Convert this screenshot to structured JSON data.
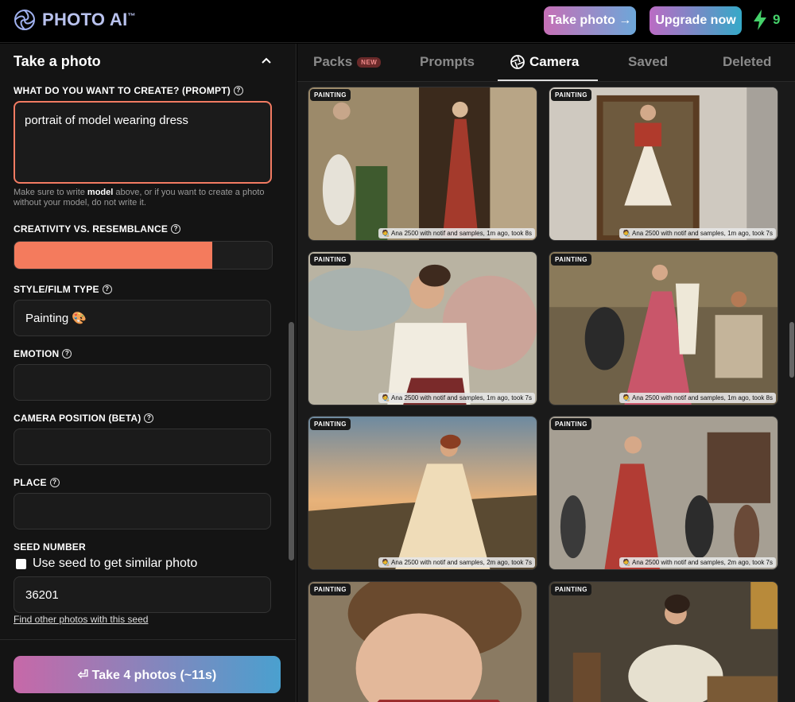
{
  "header": {
    "brand": "PHOTO AI",
    "brand_mark": "™",
    "take_photo_label": "Take photo →",
    "upgrade_label": "Upgrade now",
    "credits": "9",
    "colors": {
      "take_photo": "#c66fb6",
      "upgrade": "#35a9c8",
      "credits": "#45d16a"
    }
  },
  "form": {
    "section_title": "Take a photo",
    "prompt_label": "WHAT DO YOU WANT TO CREATE? (PROMPT)",
    "prompt_value": "portrait of model wearing dress",
    "hint_before": "Make sure to write ",
    "hint_bold": "model",
    "hint_after": " above, or if you want to create a photo without your model, do not write it.",
    "creativity_label": "CREATIVITY VS. RESEMBLANCE",
    "creativity_value": 0.77,
    "style_label": "STYLE/FILM TYPE",
    "style_value": "Painting 🎨",
    "emotion_label": "EMOTION",
    "emotion_value": "",
    "camera_label": "CAMERA POSITION (BETA)",
    "camera_value": "",
    "place_label": "PLACE",
    "place_value": "",
    "seed_label": "SEED NUMBER",
    "seed_checkbox_label": "Use seed to get similar photo",
    "seed_value": "36201",
    "seed_link": "Find other photos with this seed",
    "submit_label": "⏎ Take 4 photos (~11s)",
    "accent": "#f47b5d"
  },
  "tabs": [
    {
      "label": "Packs",
      "badge": "NEW"
    },
    {
      "label": "Prompts"
    },
    {
      "label": "Camera",
      "active": true
    },
    {
      "label": "Saved"
    },
    {
      "label": "Deleted"
    }
  ],
  "gallery": [
    {
      "badge": "PAINTING",
      "meta": "🧑‍🎨 Ana 2500 with notif and samples, 1m ago, took 8s"
    },
    {
      "badge": "PAINTING",
      "meta": "🧑‍🎨 Ana 2500 with notif and samples, 1m ago, took 7s"
    },
    {
      "badge": "PAINTING",
      "meta": "🧑‍🎨 Ana 2500 with notif and samples, 1m ago, took 7s"
    },
    {
      "badge": "PAINTING",
      "meta": "🧑‍🎨 Ana 2500 with notif and samples, 1m ago, took 8s"
    },
    {
      "badge": "PAINTING",
      "meta": "🧑‍🎨 Ana 2500 with notif and samples, 2m ago, took 7s"
    },
    {
      "badge": "PAINTING",
      "meta": "🧑‍🎨 Ana 2500 with notif and samples, 2m ago, took 7s"
    },
    {
      "badge": "PAINTING",
      "meta": ""
    },
    {
      "badge": "PAINTING",
      "meta": ""
    }
  ]
}
